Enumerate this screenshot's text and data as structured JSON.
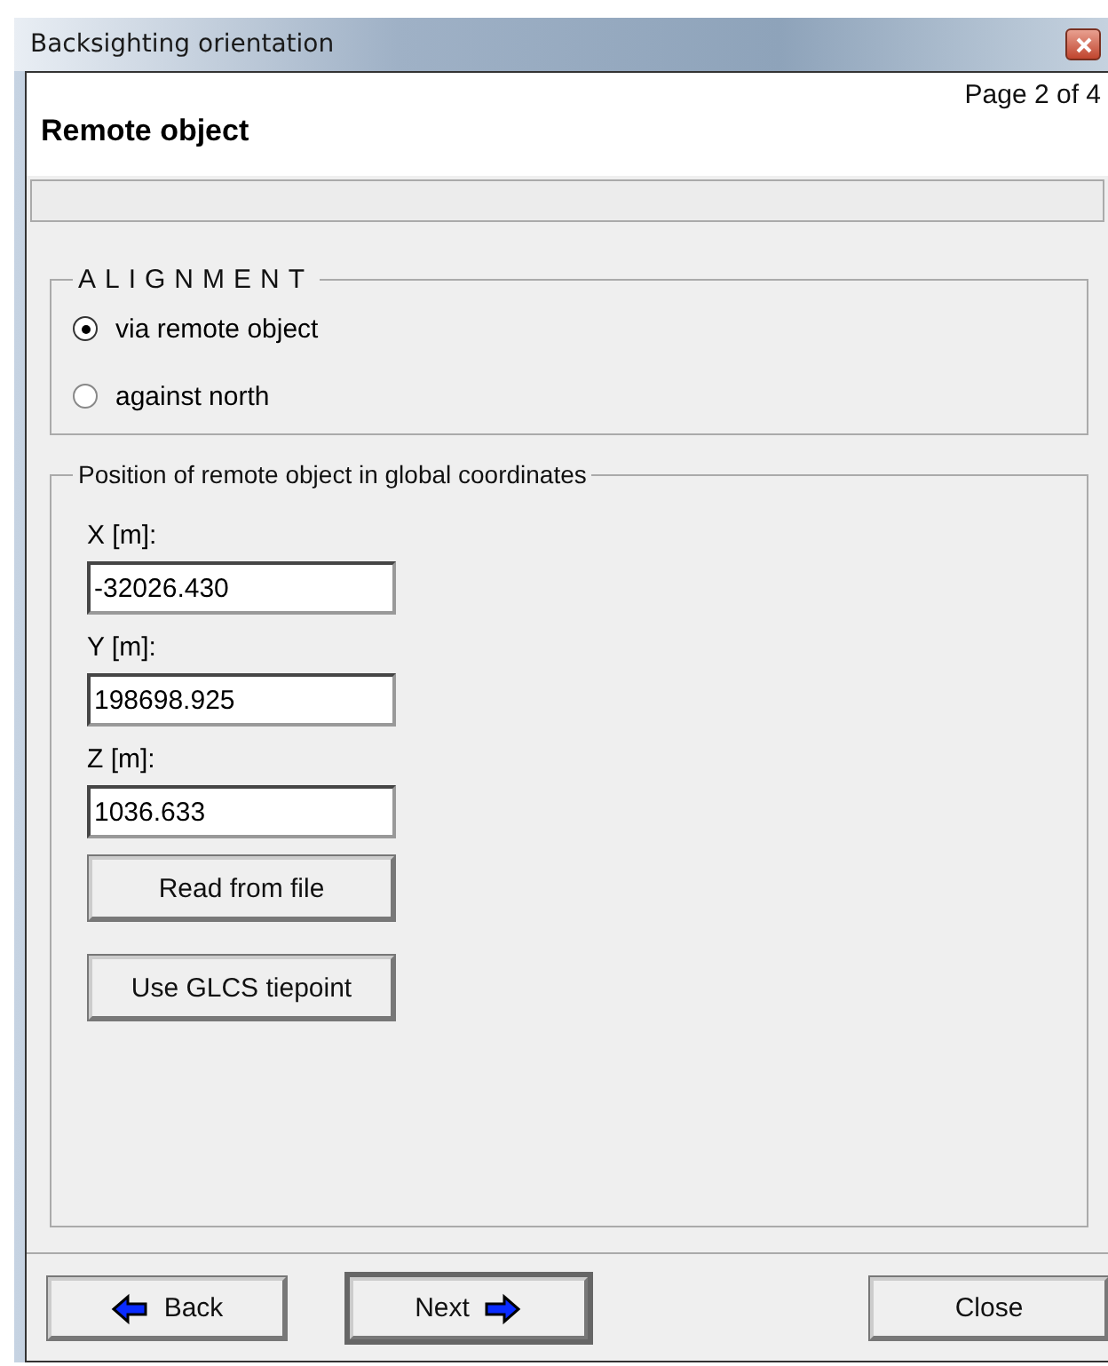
{
  "window": {
    "title": "Backsighting orientation"
  },
  "header": {
    "page": "Page 2 of 4",
    "title": "Remote object"
  },
  "alignment": {
    "legend": "ALIGNMENT",
    "options": [
      {
        "label": "via remote object",
        "selected": true
      },
      {
        "label": "against north",
        "selected": false
      }
    ]
  },
  "position": {
    "legend": "Position of remote object in global coordinates",
    "fields": [
      {
        "label": "X [m]:",
        "value": "-32026.430"
      },
      {
        "label": "Y [m]:",
        "value": "198698.925"
      },
      {
        "label": "Z [m]:",
        "value": "1036.633"
      }
    ],
    "buttons": [
      "Read from file",
      "Use GLCS tiepoint"
    ]
  },
  "nav": [
    {
      "label": "Back",
      "kind": "back",
      "default": false
    },
    {
      "label": "Next",
      "kind": "next",
      "default": true
    },
    {
      "label": "Close",
      "kind": "close",
      "default": false
    }
  ]
}
